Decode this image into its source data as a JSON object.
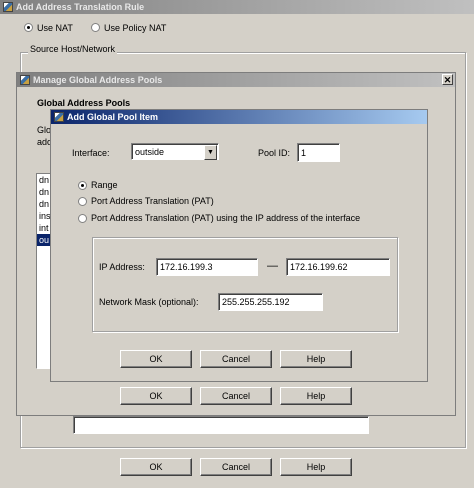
{
  "outer_dialog": {
    "title": "Add Address Translation Rule",
    "radio_use_nat": "Use NAT",
    "radio_use_policy_nat": "Use Policy NAT",
    "group_source": "Source Host/Network",
    "buttons": {
      "ok": "OK",
      "cancel": "Cancel",
      "help": "Help"
    }
  },
  "manage_dialog": {
    "title": "Manage Global Address Pools",
    "heading": "Global Address Pools",
    "truncated_text_1": "Glo",
    "truncated_text_2": "ado",
    "list_items": [
      "dn",
      "dn",
      "dn",
      "ins",
      "int",
      "ou"
    ],
    "selected_index": 5,
    "buttons": {
      "ok": "OK",
      "cancel": "Cancel",
      "help": "Help"
    }
  },
  "add_pool_dialog": {
    "title": "Add Global Pool Item",
    "interface_label": "Interface:",
    "interface_value": "outside",
    "pool_id_label": "Pool ID:",
    "pool_id_value": "1",
    "radio_range": "Range",
    "radio_pat": "Port Address Translation (PAT)",
    "radio_pat_interface": "Port Address Translation (PAT) using the IP address of the interface",
    "ip_address_label": "IP Address:",
    "ip_start": "172.16.199.3",
    "ip_separator": "—",
    "ip_end": "172.16.199.62",
    "netmask_label": "Network Mask (optional):",
    "netmask_value": "255.255.255.192",
    "buttons": {
      "ok": "OK",
      "cancel": "Cancel",
      "help": "Help"
    }
  }
}
